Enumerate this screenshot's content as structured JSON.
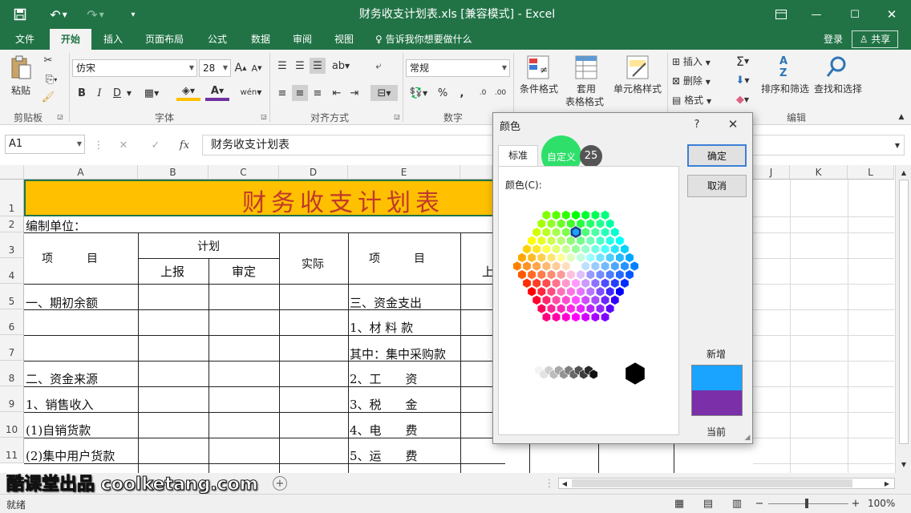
{
  "window": {
    "title": "财务收支计划表.xls [兼容模式] - Excel",
    "login": "登录",
    "share": "共享"
  },
  "tabs": [
    "文件",
    "开始",
    "插入",
    "页面布局",
    "公式",
    "数据",
    "审阅",
    "视图"
  ],
  "tell_me": "告诉我你想要做什么",
  "ribbon": {
    "clipboard": {
      "label": "剪贴板",
      "paste": "粘贴"
    },
    "font": {
      "label": "字体",
      "name": "仿宋",
      "size": "28",
      "bold": "B",
      "italic": "I",
      "underline": "D"
    },
    "alignment": {
      "label": "对齐方式"
    },
    "number": {
      "label": "数字",
      "format": "常规"
    },
    "styles": {
      "conditional": "条件格式",
      "table_line1": "套用",
      "table_line2": "表格格式",
      "cell_styles": "单元格样式"
    },
    "cells": {
      "insert": "插入",
      "delete": "删除",
      "format": "格式"
    },
    "editing": {
      "label": "编辑",
      "sort": "排序和筛选",
      "find": "查找和选择"
    }
  },
  "formula_bar": {
    "name_box": "A1",
    "fx": "fx",
    "content": "财务收支计划表"
  },
  "columns": [
    "A",
    "B",
    "C",
    "D",
    "E",
    "J",
    "K",
    "L"
  ],
  "rows": [
    "1",
    "2",
    "3",
    "4",
    "5",
    "6",
    "7",
    "8",
    "9",
    "10",
    "11"
  ],
  "sheet": {
    "title": "财务收支计划表",
    "unit": "编制单位：",
    "header_item": "项　　　目",
    "header_plan": "计划",
    "header_reported": "上报",
    "header_approved": "审定",
    "header_actual": "实际",
    "header_item2": "项　　　目",
    "header_reported2": "上",
    "left_items": [
      "一、期初余额",
      "",
      "",
      "二、资金来源",
      "1、销售收入",
      "(1)自销货款",
      "(2)集中用户货款"
    ],
    "right_items": [
      "三、资金支出",
      "1、材 料 款",
      "其中：集中采购款",
      "2、工　　资",
      "3、税　　金",
      "4、电　　费",
      "5、运　　费"
    ]
  },
  "status": {
    "ready": "就绪",
    "zoom": "100%"
  },
  "watermark": "酷课堂出品 coolketang.com",
  "dialog": {
    "title": "颜色",
    "help": "?",
    "close": "✕",
    "tab_standard": "标准",
    "tab_custom": "自定义",
    "step_badge": "25",
    "colors_label": "颜色(C):",
    "ok": "确定",
    "cancel": "取消",
    "new_label": "新增",
    "current_label": "当前",
    "new_color": "#1aa3ff",
    "current_color": "#7b2fa8"
  }
}
